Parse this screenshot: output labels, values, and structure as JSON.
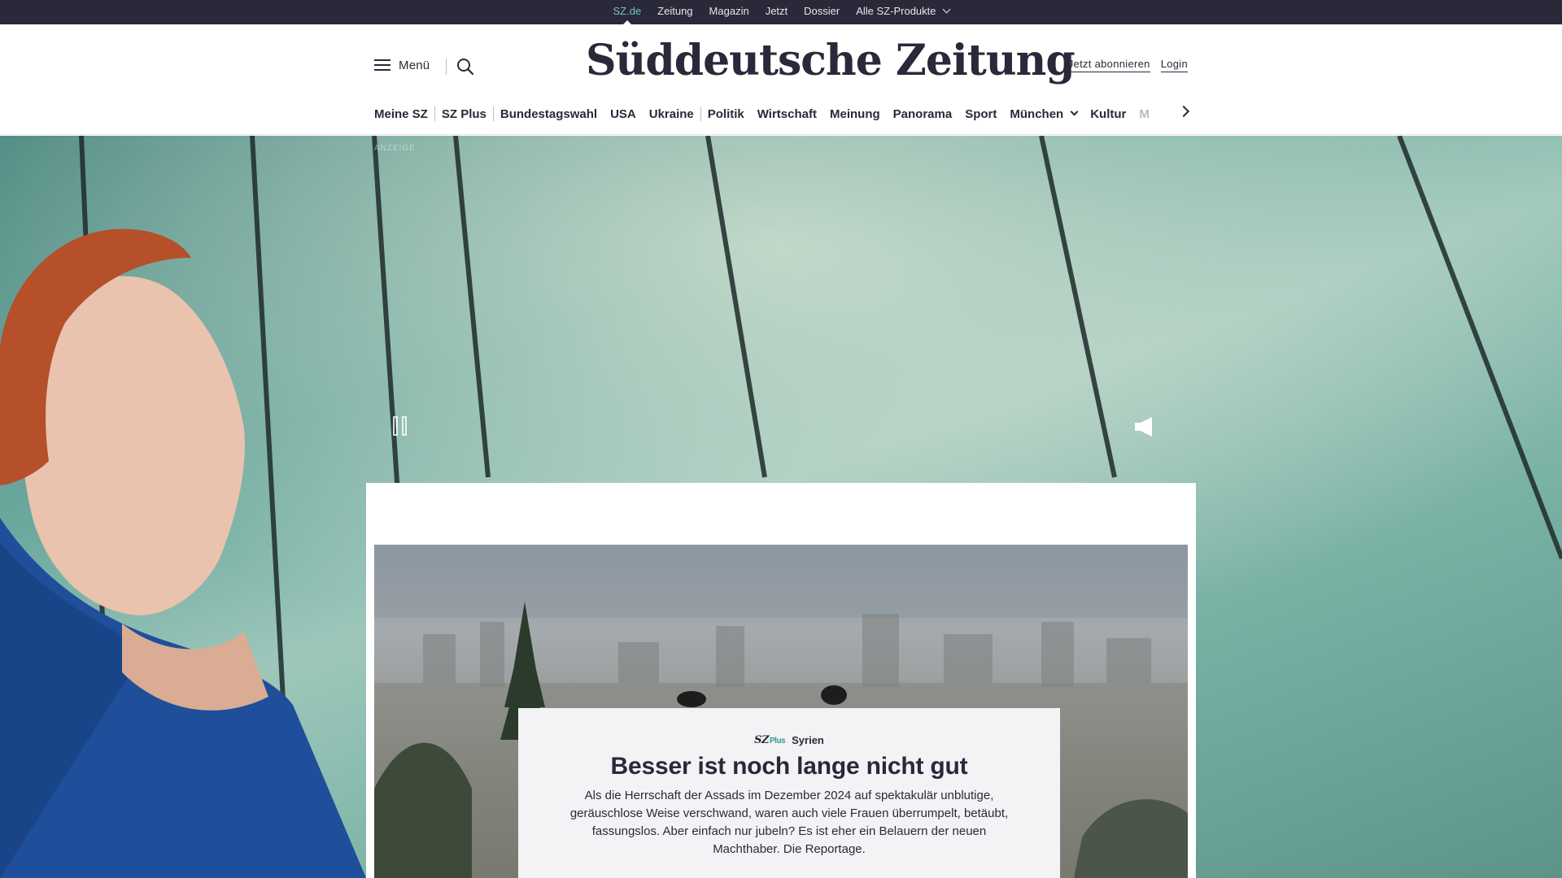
{
  "topbar": {
    "items": [
      {
        "label": "SZ.de",
        "active": true
      },
      {
        "label": "Zeitung"
      },
      {
        "label": "Magazin"
      },
      {
        "label": "Jetzt"
      },
      {
        "label": "Dossier"
      },
      {
        "label": "Alle SZ-Produkte",
        "dropdown": true
      }
    ]
  },
  "header": {
    "menu_label": "Menü",
    "logo": "Süddeutsche Zeitung",
    "subscribe_label": "Jetzt abonnieren",
    "login_label": "Login"
  },
  "nav": {
    "items": [
      {
        "label": "Meine SZ"
      },
      {
        "label": "SZ Plus"
      },
      {
        "label": "Bundestagswahl"
      },
      {
        "label": "USA"
      },
      {
        "label": "Ukraine"
      },
      {
        "label": "Politik"
      },
      {
        "label": "Wirtschaft"
      },
      {
        "label": "Meinung"
      },
      {
        "label": "Panorama"
      },
      {
        "label": "Sport"
      },
      {
        "label": "München"
      },
      {
        "label": "Kultur"
      },
      {
        "label": "M"
      }
    ]
  },
  "ad": {
    "label": "ANZEIGE"
  },
  "teaser": {
    "brand": "SZ",
    "brand_plus": "Plus",
    "kicker": "Syrien",
    "headline": "Besser ist noch lange nicht gut",
    "summary": "Als die Herrschaft der Assads im Dezember 2024 auf spektakulär unblutige, geräuschlose Weise verschwand, waren auch viele Frauen überrumpelt, betäubt, fassungslos. Aber einfach nur jubeln? Es ist eher ein Belauern der neuen Machthaber. Die Reportage."
  },
  "colors": {
    "topbar_bg": "#29293a",
    "accent": "#71c3ba",
    "text": "#29293a"
  }
}
